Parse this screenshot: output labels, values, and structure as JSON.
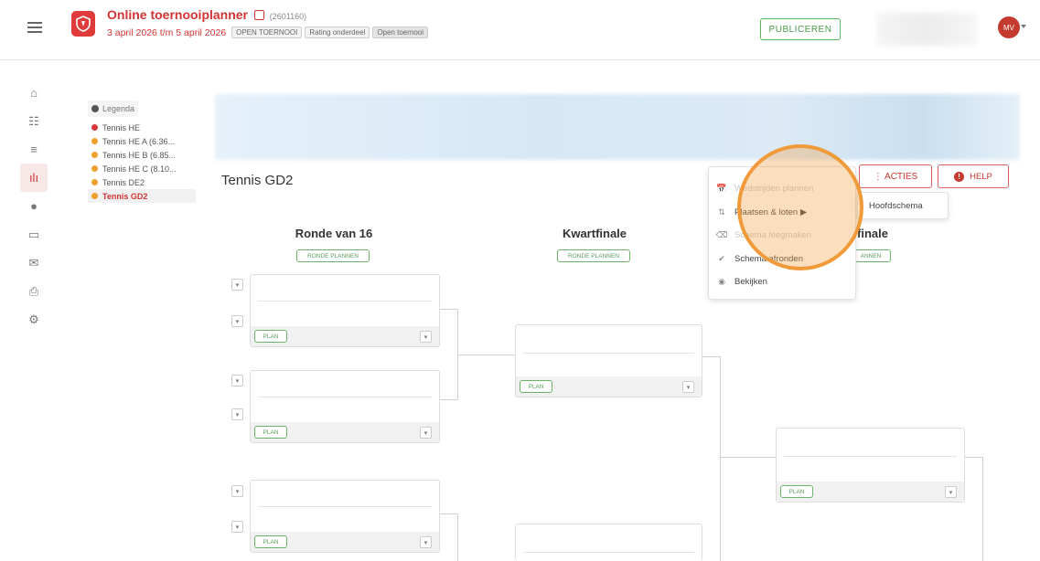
{
  "header": {
    "app_title": "Online toernooiplanner",
    "tournament_id": "(2601160)",
    "dates": "3 april 2026 t/m 5 april 2026",
    "tags": [
      "OPEN TOERNOOI",
      "Rating onderdeel",
      "Open toernooi"
    ],
    "publish_label": "PUBLICEREN",
    "avatar_initials": "MV"
  },
  "colors": {
    "brand": "#d13434",
    "accent_green": "#5cb85c",
    "highlight": "#f09a3a"
  },
  "sidebar": {
    "icons": [
      "home-icon",
      "users-icon",
      "list-icon",
      "bracket-icon",
      "ball-icon",
      "screen-icon",
      "mail-icon",
      "print-icon",
      "settings-icon"
    ],
    "active_index": 3
  },
  "legend": {
    "title": "Legenda",
    "items": [
      {
        "label": "Tennis HE",
        "color": "#d9363e"
      },
      {
        "label": "Tennis HE A (6.36...",
        "color": "#f0a030"
      },
      {
        "label": "Tennis HE B (6.85...",
        "color": "#f0a030"
      },
      {
        "label": "Tennis HE C (8.10...",
        "color": "#f0a030"
      },
      {
        "label": "Tennis DE2",
        "color": "#f0a030"
      },
      {
        "label": "Tennis GD2",
        "color": "#f0a030",
        "active": true
      }
    ]
  },
  "main": {
    "event_title": "Tennis GD2",
    "rounds": [
      {
        "title": "Ronde van 16",
        "button": "RONDE PLANNEN"
      },
      {
        "title": "Kwartfinale",
        "button": "RONDE PLANNEN"
      },
      {
        "title": "finale",
        "button": "ANNEN"
      }
    ],
    "plan_label": "PLAN",
    "dropdown_glyph": "▾"
  },
  "actions": {
    "acties_label": "⋮ ACTIES",
    "help_label": "HELP",
    "menu": [
      {
        "label": "Wedstrijden plannen",
        "icon": "calendar-icon",
        "glyph": "📅",
        "disabled": true
      },
      {
        "label": "Plaatsen & loten ▶",
        "icon": "sort-icon",
        "glyph": "⇅",
        "disabled": false
      },
      {
        "label": "Schema leegmaken",
        "icon": "eraser-icon",
        "glyph": "⌫",
        "disabled": true
      },
      {
        "label": "Schema afronden",
        "icon": "check-icon",
        "glyph": "✔",
        "disabled": false
      },
      {
        "label": "Bekijken",
        "icon": "eye-icon",
        "glyph": "◉",
        "disabled": false
      }
    ],
    "submenu_label": "Hoofdschema"
  }
}
